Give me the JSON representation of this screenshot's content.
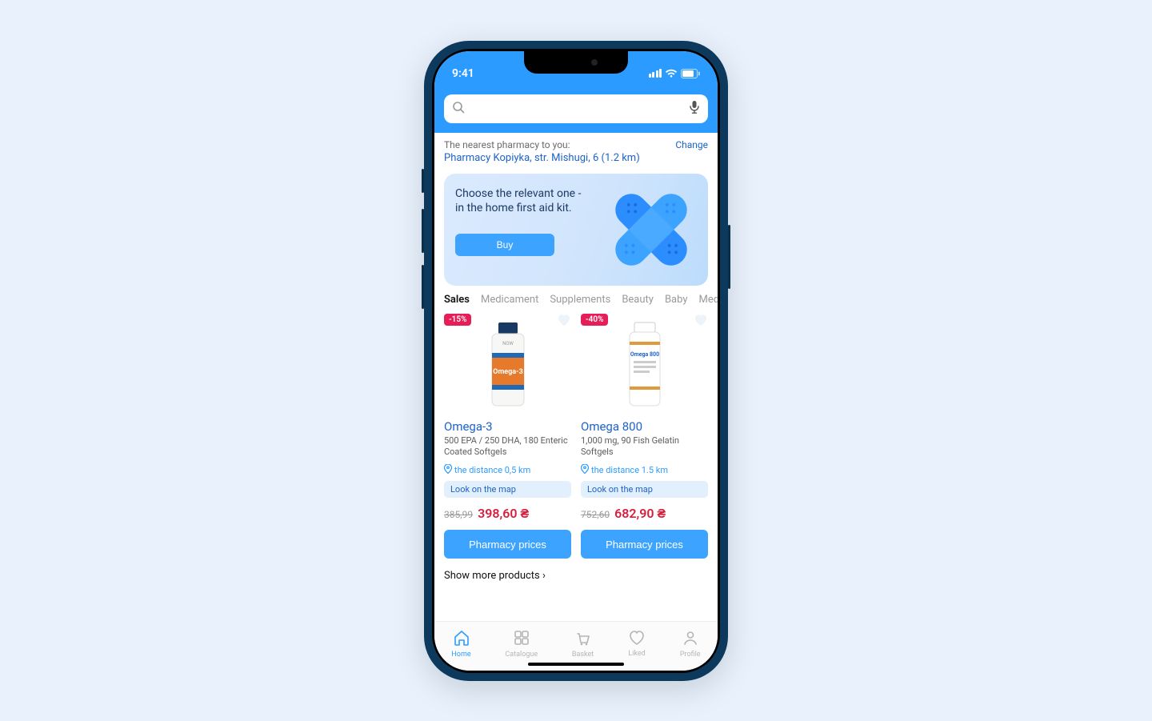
{
  "status": {
    "time": "9:41"
  },
  "search": {
    "placeholder": ""
  },
  "nearest": {
    "label": "The nearest pharmacy to you:",
    "change": "Change",
    "address": "Pharmacy Kopiyka, str. Mishugi, 6 (1.2 km)"
  },
  "banner": {
    "line1": "Choose the relevant one -",
    "line2": "in the home first aid kit.",
    "buy": "Buy"
  },
  "tabs": [
    "Sales",
    "Medicament",
    "Supplements",
    "Beauty",
    "Baby",
    "Medica"
  ],
  "products": [
    {
      "badge": "-15%",
      "title": "Omega-3",
      "desc": "500 EPA / 250 DHA, 180 Enteric Coated Softgels",
      "distance": "the distance 0,5 km",
      "map": "Look on the map",
      "old_price": "385,99",
      "new_price": "398,60 ₴",
      "button": "Pharmacy prices"
    },
    {
      "badge": "-40%",
      "title": "Omega 800",
      "desc": "1,000 mg, 90 Fish Gelatin Softgels",
      "distance": "the distance 1.5 km",
      "map": "Look on the map",
      "old_price": "752,60",
      "new_price": "682,90 ₴",
      "button": "Pharmacy prices"
    }
  ],
  "show_more": "Show more products  ›",
  "tabbar": {
    "home": "Home",
    "catalogue": "Catalogue",
    "basket": "Basket",
    "liked": "Liked",
    "profile": "Profile"
  }
}
